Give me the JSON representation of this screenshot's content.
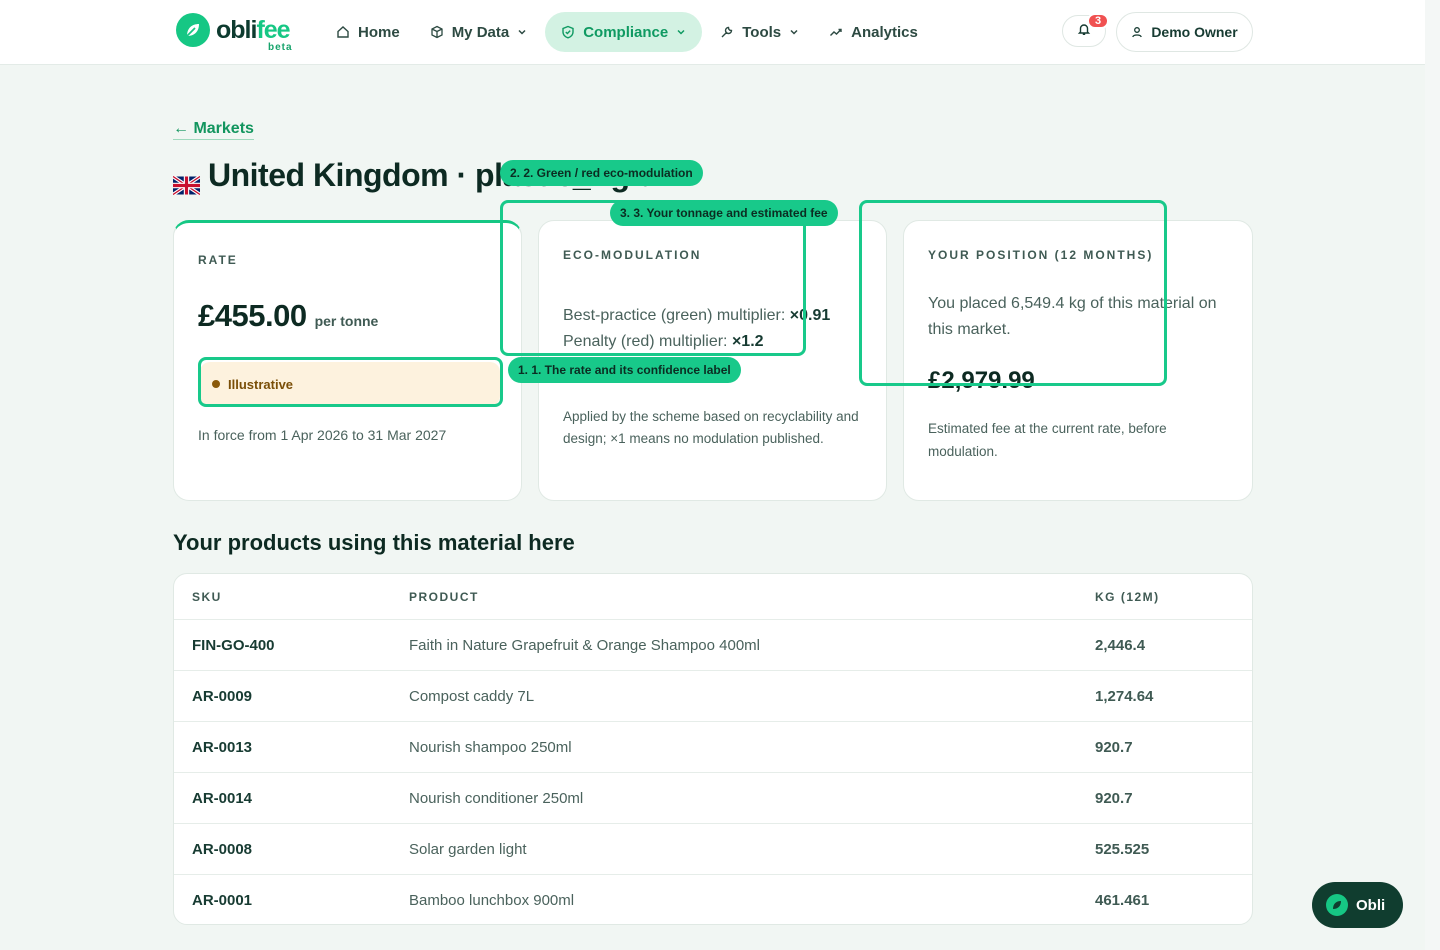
{
  "brand": {
    "name_a": "obli",
    "name_b": "fee",
    "tag": "beta"
  },
  "nav": {
    "items": [
      {
        "label": "Home",
        "icon": "home-icon"
      },
      {
        "label": "My Data",
        "icon": "cube-icon",
        "has_menu": true
      },
      {
        "label": "Compliance",
        "icon": "shield-icon",
        "has_menu": true,
        "active": true
      },
      {
        "label": "Tools",
        "icon": "wrench-icon",
        "has_menu": true
      },
      {
        "label": "Analytics",
        "icon": "trend-icon"
      }
    ],
    "notifications_count": "3",
    "user_label": "Demo Owner"
  },
  "breadcrumb": {
    "back_label": "← Markets"
  },
  "page": {
    "title": "United Kingdom · plastic_rigid",
    "flag": "uk-flag"
  },
  "rate_card": {
    "label": "RATE",
    "amount": "£455.00",
    "unit": "per tonne",
    "confidence": "Illustrative",
    "in_force": "In force from 1 Apr 2026 to 31 Mar 2027"
  },
  "eco_card": {
    "label": "ECO-MODULATION",
    "green_label": "Best-practice (green) multiplier: ",
    "green_value": "×0.91",
    "red_label": "Penalty (red) multiplier: ",
    "red_value": "×1.2",
    "note": "Applied by the scheme based on recyclability and design; ×1 means no modulation published."
  },
  "position_card": {
    "label": "YOUR POSITION (12 MONTHS)",
    "text": "You placed 6,549.4 kg of this material on this market.",
    "fee": "£2,979.99",
    "note": "Estimated fee at the current rate, before modulation."
  },
  "products": {
    "title": "Your products using this material here",
    "columns": {
      "sku": "SKU",
      "product": "PRODUCT",
      "kg": "KG (12M)"
    },
    "rows": [
      {
        "sku": "FIN-GO-400",
        "product": "Faith in Nature Grapefruit & Orange Shampoo 400ml",
        "kg": "2,446.4"
      },
      {
        "sku": "AR-0009",
        "product": "Compost caddy 7L",
        "kg": "1,274.64"
      },
      {
        "sku": "AR-0013",
        "product": "Nourish shampoo 250ml",
        "kg": "920.7"
      },
      {
        "sku": "AR-0014",
        "product": "Nourish conditioner 250ml",
        "kg": "920.7"
      },
      {
        "sku": "AR-0008",
        "product": "Solar garden light",
        "kg": "525.525"
      },
      {
        "sku": "AR-0001",
        "product": "Bamboo lunchbox 900ml",
        "kg": "461.461"
      }
    ]
  },
  "tour": {
    "step1": "1. 1. The rate and its confidence label",
    "step2": "2. 2. Green / red eco-modulation",
    "step3": "3. 3. Your tonnage and estimated fee"
  },
  "assistant": {
    "label": "Obli"
  },
  "colors": {
    "accent": "#16c784",
    "dark": "#0d2a22",
    "badge": "#f05151",
    "warning_bg": "#fdf2de"
  }
}
